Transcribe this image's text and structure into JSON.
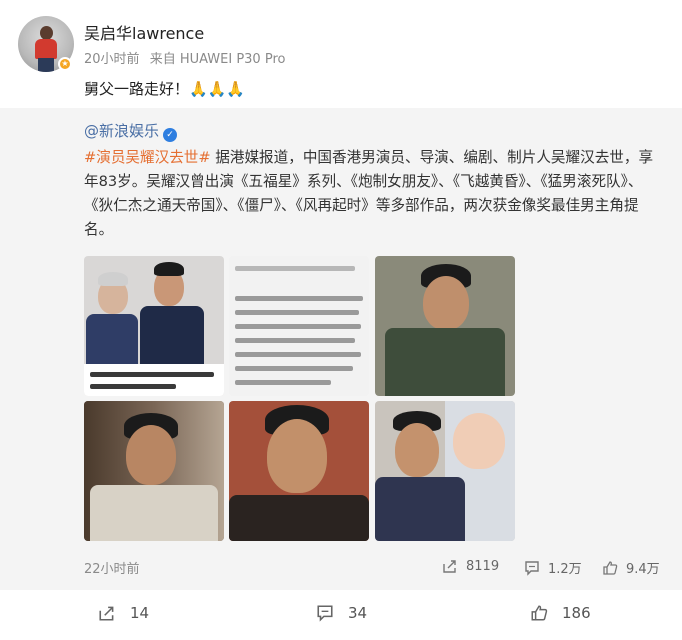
{
  "post": {
    "user_name": "吴启华lawrence",
    "time": "20小时前",
    "source": "来自 HUAWEI P30 Pro",
    "text": "舅父一路走好！",
    "emoji": "🙏🙏🙏"
  },
  "repost": {
    "author": "@新浪娱乐",
    "verified_mark": "✓",
    "topic": "#演员吴耀汉去世#",
    "body": " 据港媒报道，中国香港男演员、导演、编剧、制片人吴耀汉去世，享年83岁。吴耀汉曾出演《五福星》系列、《炮制女朋友》、《飞越黄昏》、《猛男滚死队》、《狄仁杰之通天帝国》、《僵尸》、《风再起时》等多部作品，两次获金像奖最佳男主角提名。",
    "time": "22小时前",
    "stats": {
      "reposts": "8119",
      "comments": "1.2万",
      "likes": "9.4万"
    }
  },
  "footer": {
    "reposts": "14",
    "comments": "34",
    "likes": "186"
  },
  "icons": {
    "avatar_badge": "star-badge-icon",
    "share": "share-icon",
    "comment": "comment-icon",
    "like": "thumbs-up-icon"
  },
  "colors": {
    "topic": "#e56f32",
    "author_link": "#4a6fa5",
    "verified_blue": "#2e7ee0",
    "badge_gold": "#f5a623"
  }
}
